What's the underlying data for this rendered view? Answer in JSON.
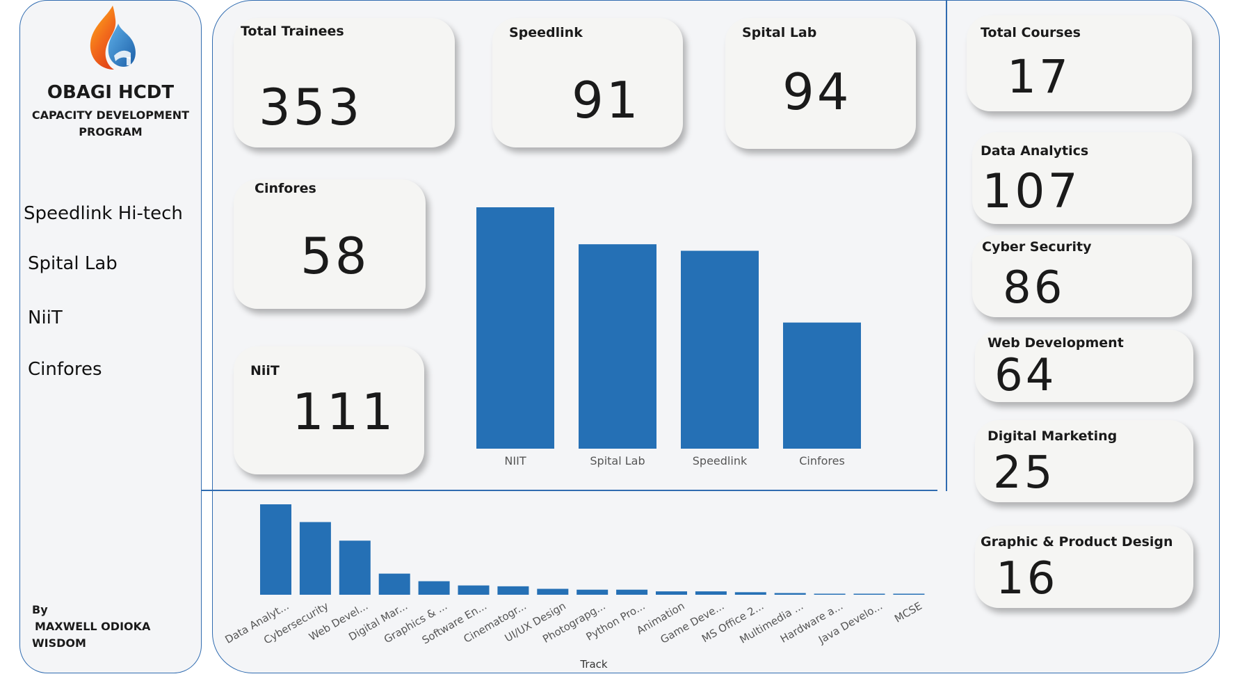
{
  "sidebar": {
    "logo_icon": "flame-drop-logo",
    "title": "OBAGI HCDT",
    "subtitle_line1": "CAPACITY DEVELOPMENT",
    "subtitle_line2": "PROGRAM",
    "nav": [
      "Speedlink Hi-tech",
      "Spital Lab",
      "NiiT",
      "Cinfores"
    ],
    "author_by": "By",
    "author_line1": "MAXWELL ODIOKA",
    "author_line2": "WISDOM"
  },
  "cards": {
    "total_trainees": {
      "title": "Total Trainees",
      "value": "353"
    },
    "speedlink": {
      "title": "Speedlink",
      "value": "91"
    },
    "spital_lab": {
      "title": "Spital Lab",
      "value": "94"
    },
    "cinfores": {
      "title": "Cinfores",
      "value": "58"
    },
    "niit": {
      "title": "NiiT",
      "value": "111"
    }
  },
  "course_cards": {
    "total_courses": {
      "title": "Total Courses",
      "value": "17"
    },
    "data_analytics": {
      "title": "Data Analytics",
      "value": "107"
    },
    "cyber_security": {
      "title": "Cyber Security",
      "value": "86"
    },
    "web_development": {
      "title": "Web Development",
      "value": "64"
    },
    "digital_marketing": {
      "title": "Digital Marketing",
      "value": "25"
    },
    "graphic_design": {
      "title": "Graphic & Product Design",
      "value": "16"
    }
  },
  "colors": {
    "accent": "#2f6bb0",
    "bar": "#2570b5",
    "card": "#f5f5f3",
    "panel": "#f4f5f7"
  },
  "chart_data": [
    {
      "type": "bar",
      "title": "",
      "xlabel": "",
      "ylabel": "",
      "categories": [
        "NIIT",
        "Spital Lab",
        "Speedlink",
        "Cinfores"
      ],
      "values": [
        111,
        94,
        91,
        58
      ],
      "ylim": [
        0,
        111
      ],
      "grid": false,
      "legend": "none"
    },
    {
      "type": "bar",
      "title": "",
      "xlabel": "Track",
      "ylabel": "",
      "categories": [
        "Data Analyt...",
        "Cybersecurity",
        "Web Devel...",
        "Digital Mar...",
        "Graphics & ...",
        "Software En...",
        "Cinematogr...",
        "UI/UX Design",
        "Photograpg...",
        "Python Pro...",
        "Animation",
        "Game Deve...",
        "MS Office 2...",
        "Multimedia ...",
        "Hardware a...",
        "Java Develo...",
        "MCSE"
      ],
      "values": [
        107,
        86,
        64,
        25,
        16,
        11,
        10,
        7,
        6,
        6,
        4,
        4,
        3,
        2,
        1,
        1,
        1
      ],
      "ylim": [
        0,
        107
      ],
      "grid": false,
      "legend": "none"
    }
  ]
}
